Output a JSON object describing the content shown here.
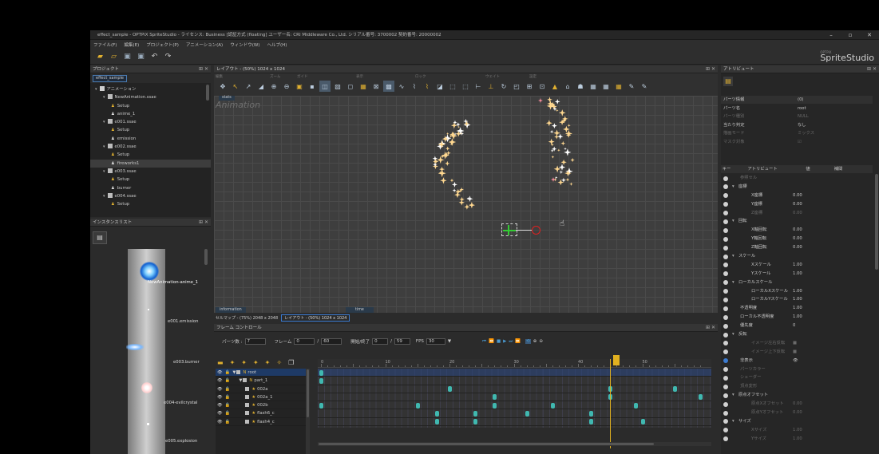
{
  "window": {
    "title": "effect_sample - OPTPiX SpriteStudio - ライセンス: Business [認証方式 (floating] ユーザー名: CRI Middleware Co., Ltd. シリアル番号: 3700002 契約番号: 20000002",
    "controls": [
      "–",
      "▫",
      "✕"
    ]
  },
  "menu": [
    "ファイル(F)",
    "編集(E)",
    "プロジェクト(P)",
    "アニメーション(A)",
    "ウィンドウ(W)",
    "ヘルプ(H)"
  ],
  "brand": {
    "sub": "OPTPiX",
    "name": "SpriteStudio"
  },
  "project": {
    "title": "プロジェクト",
    "tab": "effect_sample",
    "items": [
      {
        "label": "アニメーション",
        "depth": 0,
        "kind": "folder"
      },
      {
        "label": "NewAnimation.ssae",
        "depth": 1,
        "kind": "file"
      },
      {
        "label": "Setup",
        "depth": 2,
        "kind": "setup"
      },
      {
        "label": "anime_1",
        "depth": 2,
        "kind": "anim"
      },
      {
        "label": "e001.ssae",
        "depth": 1,
        "kind": "file"
      },
      {
        "label": "Setup",
        "depth": 2,
        "kind": "setup"
      },
      {
        "label": "emission",
        "depth": 2,
        "kind": "anim"
      },
      {
        "label": "e002.ssae",
        "depth": 1,
        "kind": "file"
      },
      {
        "label": "Setup",
        "depth": 2,
        "kind": "setup"
      },
      {
        "label": "fireworks1",
        "depth": 2,
        "kind": "anim",
        "selected": true
      },
      {
        "label": "e003.ssae",
        "depth": 1,
        "kind": "file"
      },
      {
        "label": "Setup",
        "depth": 2,
        "kind": "setup"
      },
      {
        "label": "burner",
        "depth": 2,
        "kind": "anim"
      },
      {
        "label": "e004.ssae",
        "depth": 1,
        "kind": "file"
      },
      {
        "label": "Setup",
        "depth": 2,
        "kind": "setup"
      }
    ]
  },
  "instances": {
    "title": "インスタンスリスト",
    "labels": [
      "NewAnimation-anime_1",
      "e001.emission",
      "e003.burner",
      "e004-evilcrystal",
      "e005.explosion"
    ]
  },
  "layout": {
    "title": "レイアウト - (50%) 1024 x 1024",
    "groups": [
      "編集",
      "ズーム",
      "ガイド",
      "表示",
      "ロック",
      "ウェイト",
      "設定"
    ],
    "tab": "stats",
    "watermark": "Animation",
    "info_tab": "information",
    "time_tab": "time",
    "status_left": "セルマップ - (75%) 2048 x 2048",
    "status_right": "レイアウト - (50%) 1024 x 1024"
  },
  "frame": {
    "title": "フレーム コントロール",
    "parts_label": "パーツ数 :",
    "parts_value": "7",
    "frame_label": "フレーム",
    "frame_value": "0",
    "frame_total": "60",
    "range_label": "開始/終了",
    "range_start": "0",
    "range_end": "59",
    "fps_label": "FPS",
    "fps_value": "30",
    "ticks": [
      "0",
      "10",
      "20",
      "30",
      "40",
      "50"
    ],
    "rows": [
      {
        "label": "root",
        "depth": 0,
        "expand": "▼",
        "sel": true
      },
      {
        "label": "part_1",
        "depth": 1,
        "expand": "▼"
      },
      {
        "label": "002a",
        "depth": 2
      },
      {
        "label": "002a_1",
        "depth": 2
      },
      {
        "label": "002b",
        "depth": 2
      },
      {
        "label": "flash6_c",
        "depth": 2
      },
      {
        "label": "flash4_c",
        "depth": 2
      }
    ]
  },
  "attribute": {
    "title": "アトリビュート",
    "info_rows": [
      {
        "name": "パーツ情報",
        "value": "(0)"
      },
      {
        "name": "パーツ名",
        "value": "root"
      },
      {
        "name": "パーツ種別",
        "value": "NULL",
        "dim": true
      },
      {
        "name": "当たり判定",
        "value": "なし"
      },
      {
        "name": "描画モード",
        "value": "ミックス",
        "dim": true
      },
      {
        "name": "マスク対象",
        "value": "☑",
        "dim": true
      }
    ],
    "headers": [
      "キー",
      "アトリビュート",
      "値",
      "補間"
    ],
    "rows": [
      {
        "name": "参照セル",
        "value": "",
        "dim": true,
        "indent": 1
      },
      {
        "name": "座標",
        "value": "",
        "group": true
      },
      {
        "name": "X座標",
        "value": "0.00",
        "indent": 2
      },
      {
        "name": "Y座標",
        "value": "0.00",
        "indent": 2
      },
      {
        "name": "Z座標",
        "value": "0.00",
        "indent": 2,
        "dim": true
      },
      {
        "name": "回転",
        "value": "",
        "group": true
      },
      {
        "name": "X軸回転",
        "value": "0.00",
        "indent": 2
      },
      {
        "name": "Y軸回転",
        "value": "0.00",
        "indent": 2
      },
      {
        "name": "Z軸回転",
        "value": "0.00",
        "indent": 2
      },
      {
        "name": "スケール",
        "value": "",
        "group": true
      },
      {
        "name": "Xスケール",
        "value": "1.00",
        "indent": 2
      },
      {
        "name": "Yスケール",
        "value": "1.00",
        "indent": 2
      },
      {
        "name": "ローカルスケール",
        "value": "",
        "group": true
      },
      {
        "name": "ローカルXスケール",
        "value": "1.00",
        "indent": 2
      },
      {
        "name": "ローカルYスケール",
        "value": "1.00",
        "indent": 2
      },
      {
        "name": "不透明度",
        "value": "1.00",
        "indent": 1
      },
      {
        "name": "ローカル不透明度",
        "value": "1.00",
        "indent": 1
      },
      {
        "name": "優先度",
        "value": "0",
        "indent": 1
      },
      {
        "name": "反転",
        "value": "",
        "group": true
      },
      {
        "name": "イメージ左右反転",
        "value": "■",
        "indent": 2,
        "dim": true
      },
      {
        "name": "イメージ上下反転",
        "value": "■",
        "indent": 2,
        "dim": true
      },
      {
        "name": "非表示",
        "value": "👁",
        "indent": 1,
        "on": true
      },
      {
        "name": "パーツカラー",
        "value": "",
        "indent": 1,
        "dim": true
      },
      {
        "name": "シェーダー",
        "value": "",
        "indent": 1,
        "dim": true
      },
      {
        "name": "頂点変形",
        "value": "",
        "indent": 1,
        "dim": true
      },
      {
        "name": "原点オフセット",
        "value": "",
        "group": true
      },
      {
        "name": "原点Xオフセット",
        "value": "0.00",
        "indent": 2,
        "dim": true
      },
      {
        "name": "原点Yオフセット",
        "value": "0.00",
        "indent": 2,
        "dim": true
      },
      {
        "name": "サイズ",
        "value": "",
        "group": true
      },
      {
        "name": "Xサイズ",
        "value": "1.00",
        "indent": 2,
        "dim": true
      },
      {
        "name": "Yサイズ",
        "value": "1.00",
        "indent": 2,
        "dim": true
      }
    ]
  },
  "colors": {
    "accent": "#3a7ad0",
    "keyframe": "#40b8b0",
    "playhead": "#e0b020",
    "sparkle": "#ffd890"
  }
}
